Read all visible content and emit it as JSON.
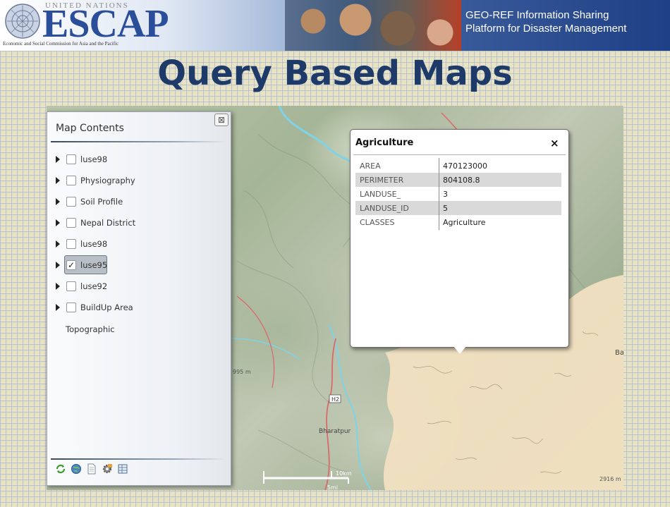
{
  "banner": {
    "org_top": "UNITED NATIONS",
    "org_name": "ESCAP",
    "org_sub": "Economic and Social Commission for Asia and the Pacific",
    "platform_line1": "GEO-REF Information Sharing",
    "platform_line2": "Platform for Disaster Management"
  },
  "slide": {
    "title": "Query Based Maps"
  },
  "panel": {
    "title": "Map Contents",
    "close_glyph": "⊠",
    "layers": [
      {
        "label": "luse98",
        "checked": false
      },
      {
        "label": "Physiography",
        "checked": false
      },
      {
        "label": "Soil Profile",
        "checked": false
      },
      {
        "label": "Nepal District",
        "checked": false
      },
      {
        "label": "luse98",
        "checked": false
      },
      {
        "label": "luse95",
        "checked": true
      },
      {
        "label": "luse92",
        "checked": false
      },
      {
        "label": "BuildUp Area",
        "checked": false
      }
    ],
    "basemap": "Topographic",
    "tools": [
      "refresh-icon",
      "globe-icon",
      "document-icon",
      "settings-icon",
      "table-icon"
    ]
  },
  "popup": {
    "title": "Agriculture",
    "close_glyph": "×",
    "rows": [
      {
        "key": "AREA",
        "value": "470123000"
      },
      {
        "key": "PERIMETER",
        "value": "804108.8"
      },
      {
        "key": "LANDUSE_",
        "value": "3"
      },
      {
        "key": "LANDUSE_ID",
        "value": "5"
      },
      {
        "key": "CLASSES",
        "value": "Agriculture"
      }
    ]
  },
  "map": {
    "labels": {
      "elev_left": "995 m",
      "road": "H2",
      "place": "Bharatpur",
      "edge": "Ba",
      "elev_right": "2916 m",
      "scale_km": "10km",
      "scale_mi": "5mi"
    },
    "colors": {
      "farmland": "#f1e0c1",
      "river": "#7fd3e6",
      "road": "#d96a6a"
    }
  }
}
